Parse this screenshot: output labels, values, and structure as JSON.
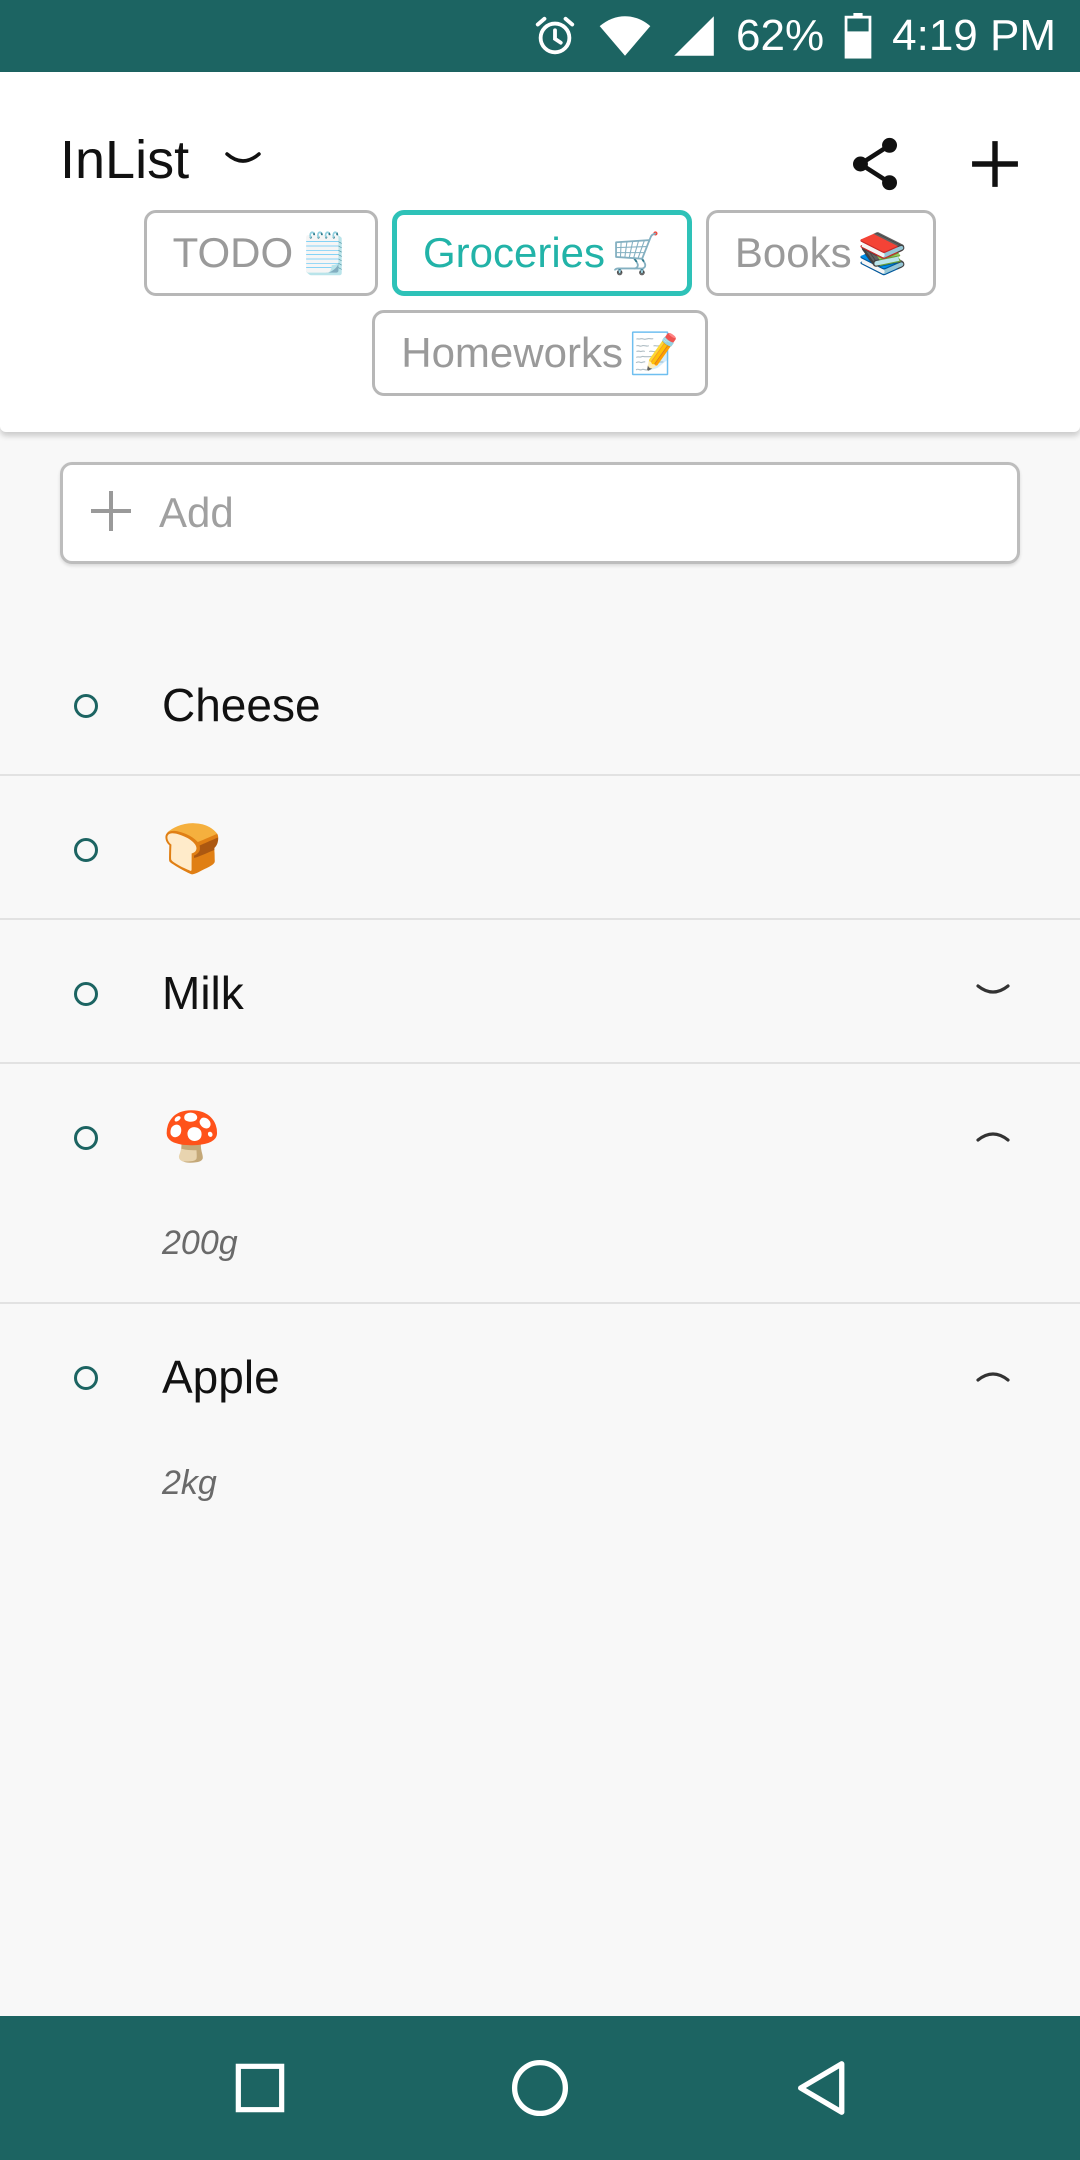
{
  "status_bar": {
    "battery": "62%",
    "time": "4:19 PM"
  },
  "header": {
    "title": "InList",
    "tabs": [
      {
        "label": "TODO",
        "emoji": "🗒️",
        "active": false
      },
      {
        "label": "Groceries",
        "emoji": "🛒",
        "active": true
      },
      {
        "label": "Books",
        "emoji": "📚",
        "active": false
      },
      {
        "label": "Homeworks",
        "emoji": "📝",
        "active": false
      }
    ]
  },
  "add": {
    "placeholder": "Add"
  },
  "items": [
    {
      "label": "Cheese",
      "note": "",
      "toggle": ""
    },
    {
      "label": "🍞",
      "note": "",
      "toggle": ""
    },
    {
      "label": "Milk",
      "note": "",
      "toggle": "chevron-down"
    },
    {
      "label": "🍄",
      "note": "200g",
      "toggle": "chevron-up"
    },
    {
      "label": "Apple",
      "note": "2kg",
      "toggle": "chevron-up"
    }
  ],
  "colors": {
    "primary": "#1c6462",
    "accent": "#2ec2b8",
    "tab_border": "#b7b7b7",
    "background": "#f8f8f8"
  },
  "icons": {
    "status": [
      "alarm-icon",
      "wifi-icon",
      "signal-icon",
      "battery-icon"
    ],
    "header": [
      "chevron-down-icon",
      "share-icon",
      "plus-icon"
    ],
    "nav": [
      "recents-square-icon",
      "home-circle-icon",
      "back-triangle-icon"
    ]
  }
}
